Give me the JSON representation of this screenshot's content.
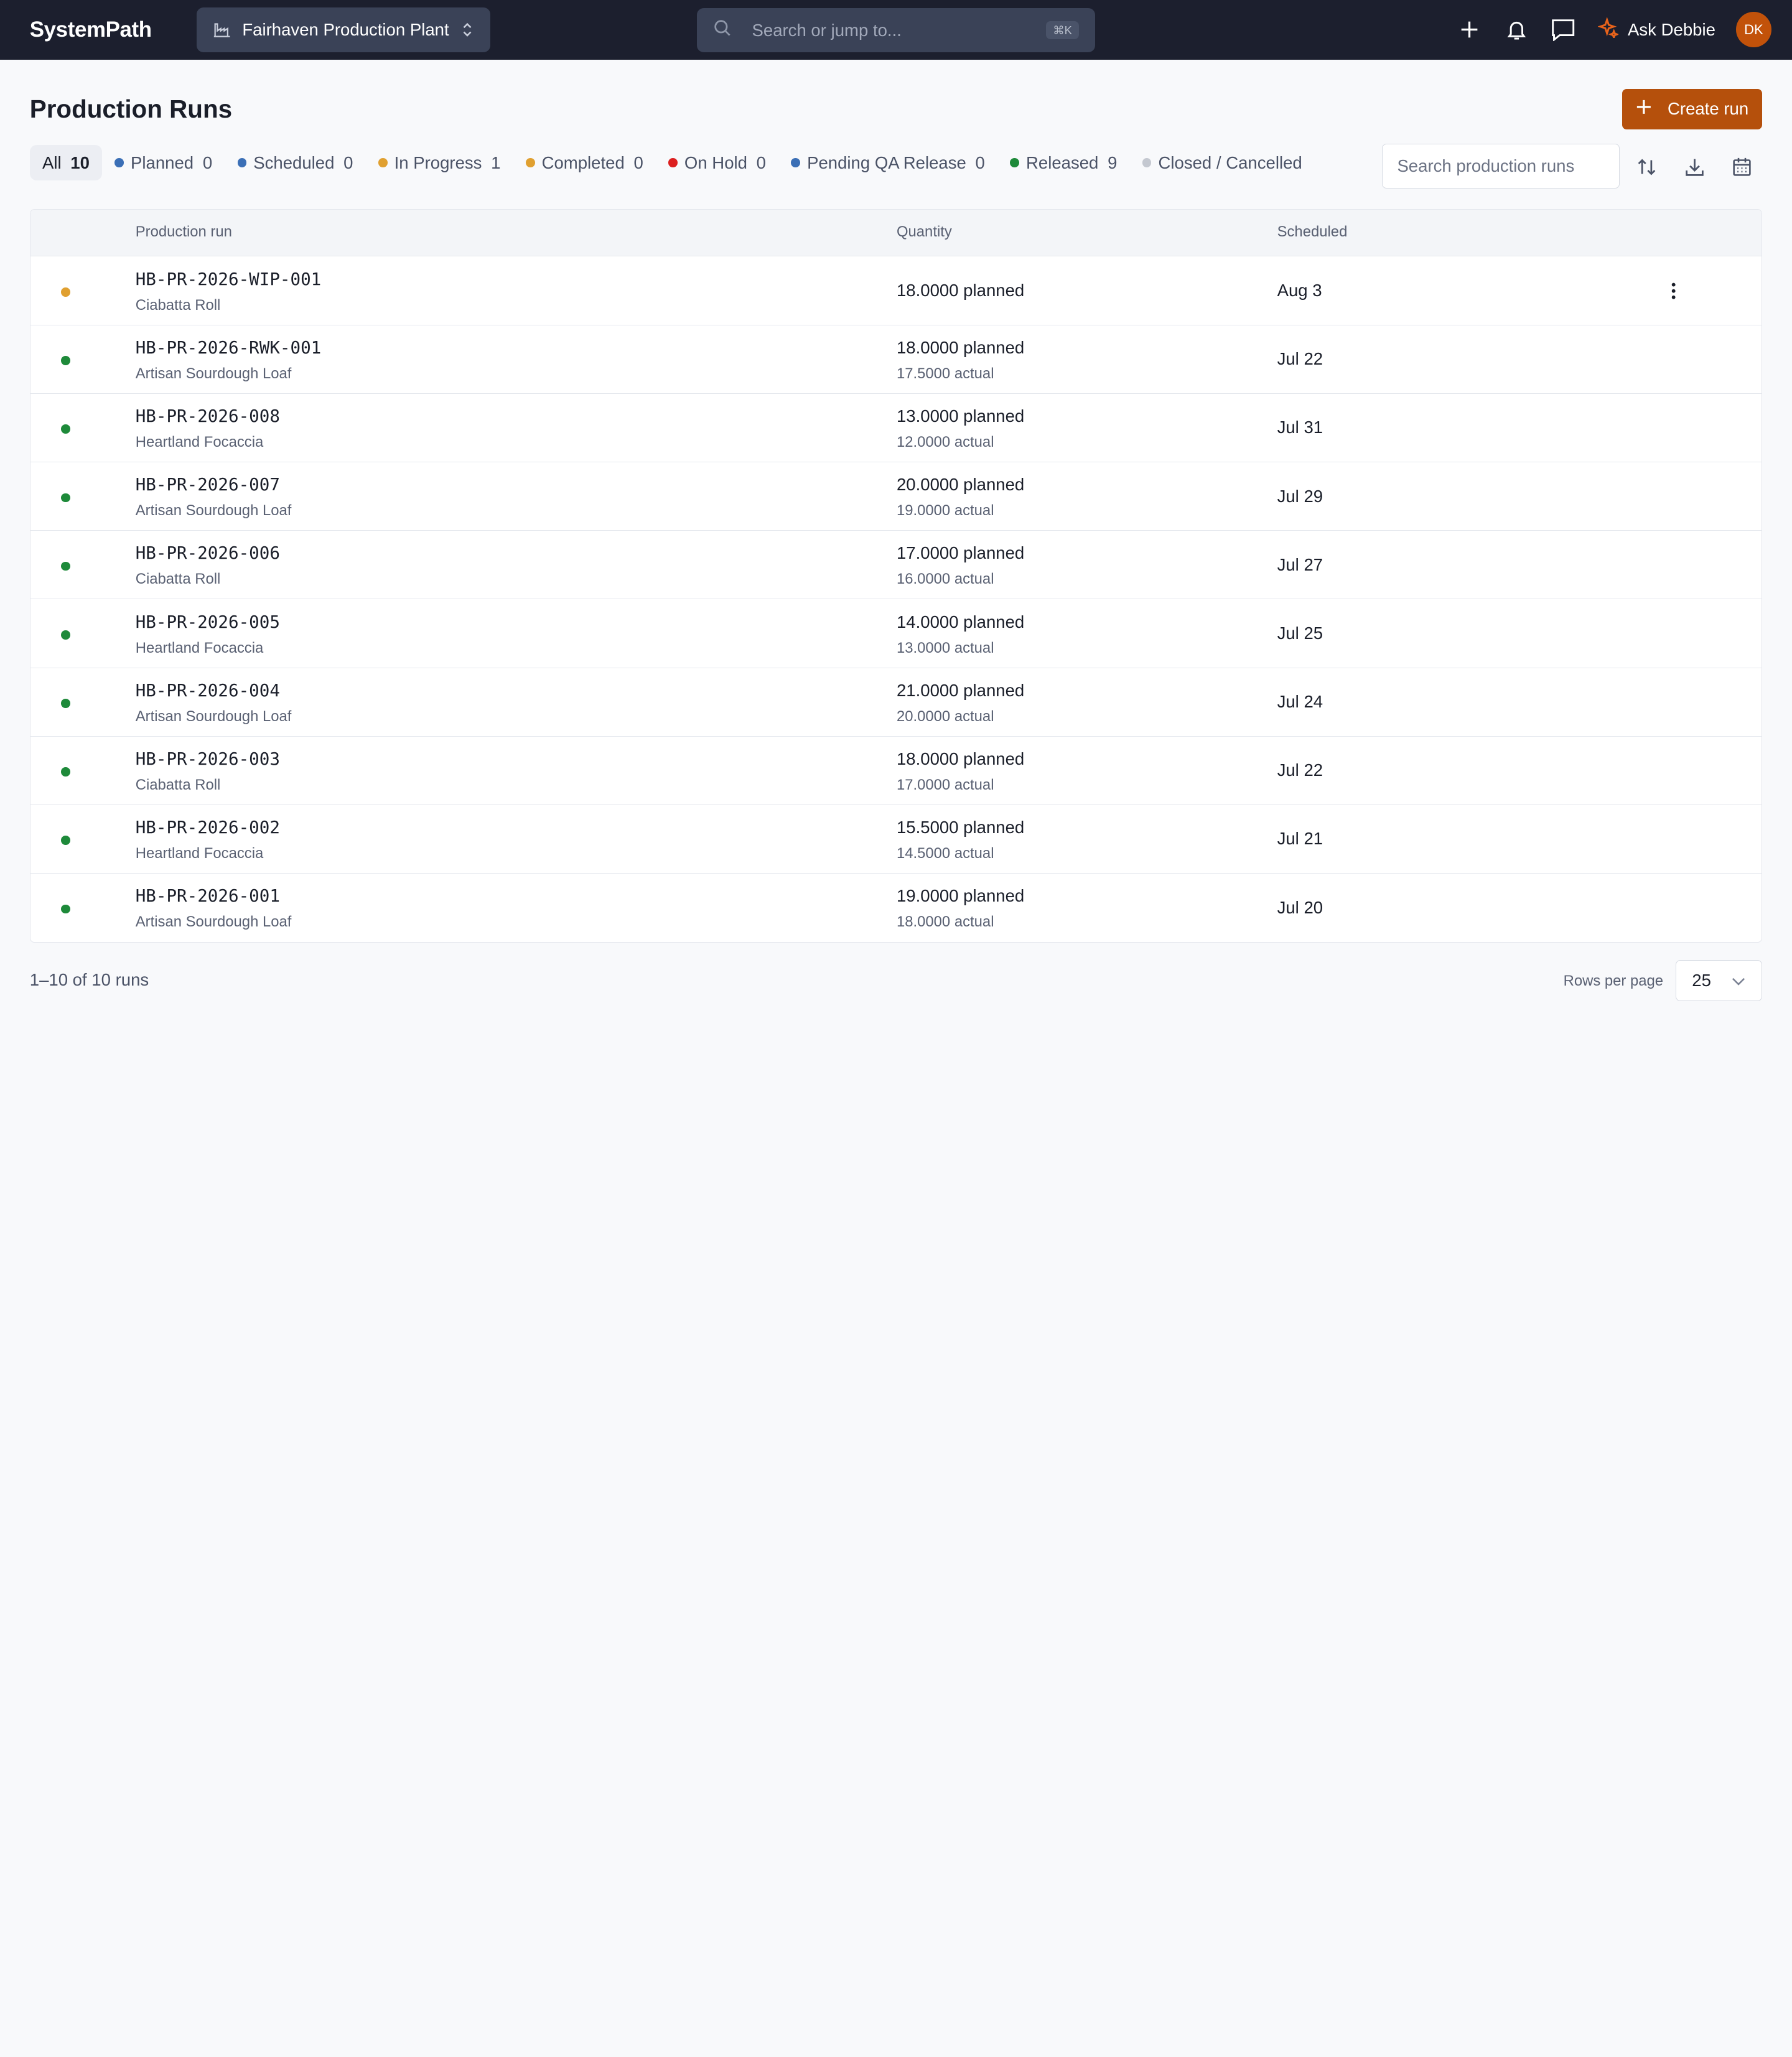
{
  "nav": {
    "brand": "SystemPath",
    "plant": "Fairhaven Production Plant",
    "search_placeholder": "Search or jump to...",
    "search_shortcut": "⌘K",
    "ask_label": "Ask Debbie",
    "avatar_initials": "DK"
  },
  "header": {
    "title": "Production Runs",
    "create_label": "Create run"
  },
  "filters": [
    {
      "label": "All",
      "count": "10",
      "color": "",
      "active": true
    },
    {
      "label": "Planned",
      "count": "0",
      "color": "#3b6fb6"
    },
    {
      "label": "Scheduled",
      "count": "0",
      "color": "#3b6fb6"
    },
    {
      "label": "In Progress",
      "count": "1",
      "color": "#e0a030"
    },
    {
      "label": "Completed",
      "count": "0",
      "color": "#e0a030"
    },
    {
      "label": "On Hold",
      "count": "0",
      "color": "#dc1f1f"
    },
    {
      "label": "Pending QA Release",
      "count": "0",
      "color": "#3b6fb6"
    },
    {
      "label": "Released",
      "count": "9",
      "color": "#1e8a3a"
    },
    {
      "label": "Closed / Cancelled",
      "count": "",
      "color": "#c4c8d0"
    }
  ],
  "search_runs_placeholder": "Search production runs",
  "table": {
    "headers": {
      "run": "Production run",
      "quantity": "Quantity",
      "scheduled": "Scheduled"
    },
    "rows": [
      {
        "code": "HB-PR-2026-WIP-001",
        "product": "Ciabatta Roll",
        "planned": "18.0000 planned",
        "actual": "",
        "scheduled": "Aug 3",
        "color": "#e0a030",
        "menu": true
      },
      {
        "code": "HB-PR-2026-RWK-001",
        "product": "Artisan Sourdough Loaf",
        "planned": "18.0000 planned",
        "actual": "17.5000 actual",
        "scheduled": "Jul 22",
        "color": "#1e8a3a"
      },
      {
        "code": "HB-PR-2026-008",
        "product": "Heartland Focaccia",
        "planned": "13.0000 planned",
        "actual": "12.0000 actual",
        "scheduled": "Jul 31",
        "color": "#1e8a3a"
      },
      {
        "code": "HB-PR-2026-007",
        "product": "Artisan Sourdough Loaf",
        "planned": "20.0000 planned",
        "actual": "19.0000 actual",
        "scheduled": "Jul 29",
        "color": "#1e8a3a"
      },
      {
        "code": "HB-PR-2026-006",
        "product": "Ciabatta Roll",
        "planned": "17.0000 planned",
        "actual": "16.0000 actual",
        "scheduled": "Jul 27",
        "color": "#1e8a3a"
      },
      {
        "code": "HB-PR-2026-005",
        "product": "Heartland Focaccia",
        "planned": "14.0000 planned",
        "actual": "13.0000 actual",
        "scheduled": "Jul 25",
        "color": "#1e8a3a"
      },
      {
        "code": "HB-PR-2026-004",
        "product": "Artisan Sourdough Loaf",
        "planned": "21.0000 planned",
        "actual": "20.0000 actual",
        "scheduled": "Jul 24",
        "color": "#1e8a3a"
      },
      {
        "code": "HB-PR-2026-003",
        "product": "Ciabatta Roll",
        "planned": "18.0000 planned",
        "actual": "17.0000 actual",
        "scheduled": "Jul 22",
        "color": "#1e8a3a"
      },
      {
        "code": "HB-PR-2026-002",
        "product": "Heartland Focaccia",
        "planned": "15.5000 planned",
        "actual": "14.5000 actual",
        "scheduled": "Jul 21",
        "color": "#1e8a3a"
      },
      {
        "code": "HB-PR-2026-001",
        "product": "Artisan Sourdough Loaf",
        "planned": "19.0000 planned",
        "actual": "18.0000 actual",
        "scheduled": "Jul 20",
        "color": "#1e8a3a"
      }
    ]
  },
  "footer": {
    "range": "1–10 of 10 runs",
    "rows_per_page_label": "Rows per page",
    "rows_per_page_value": "25"
  },
  "colors": {
    "nav_bg": "#1c1f2e",
    "accent": "#b5500c"
  }
}
